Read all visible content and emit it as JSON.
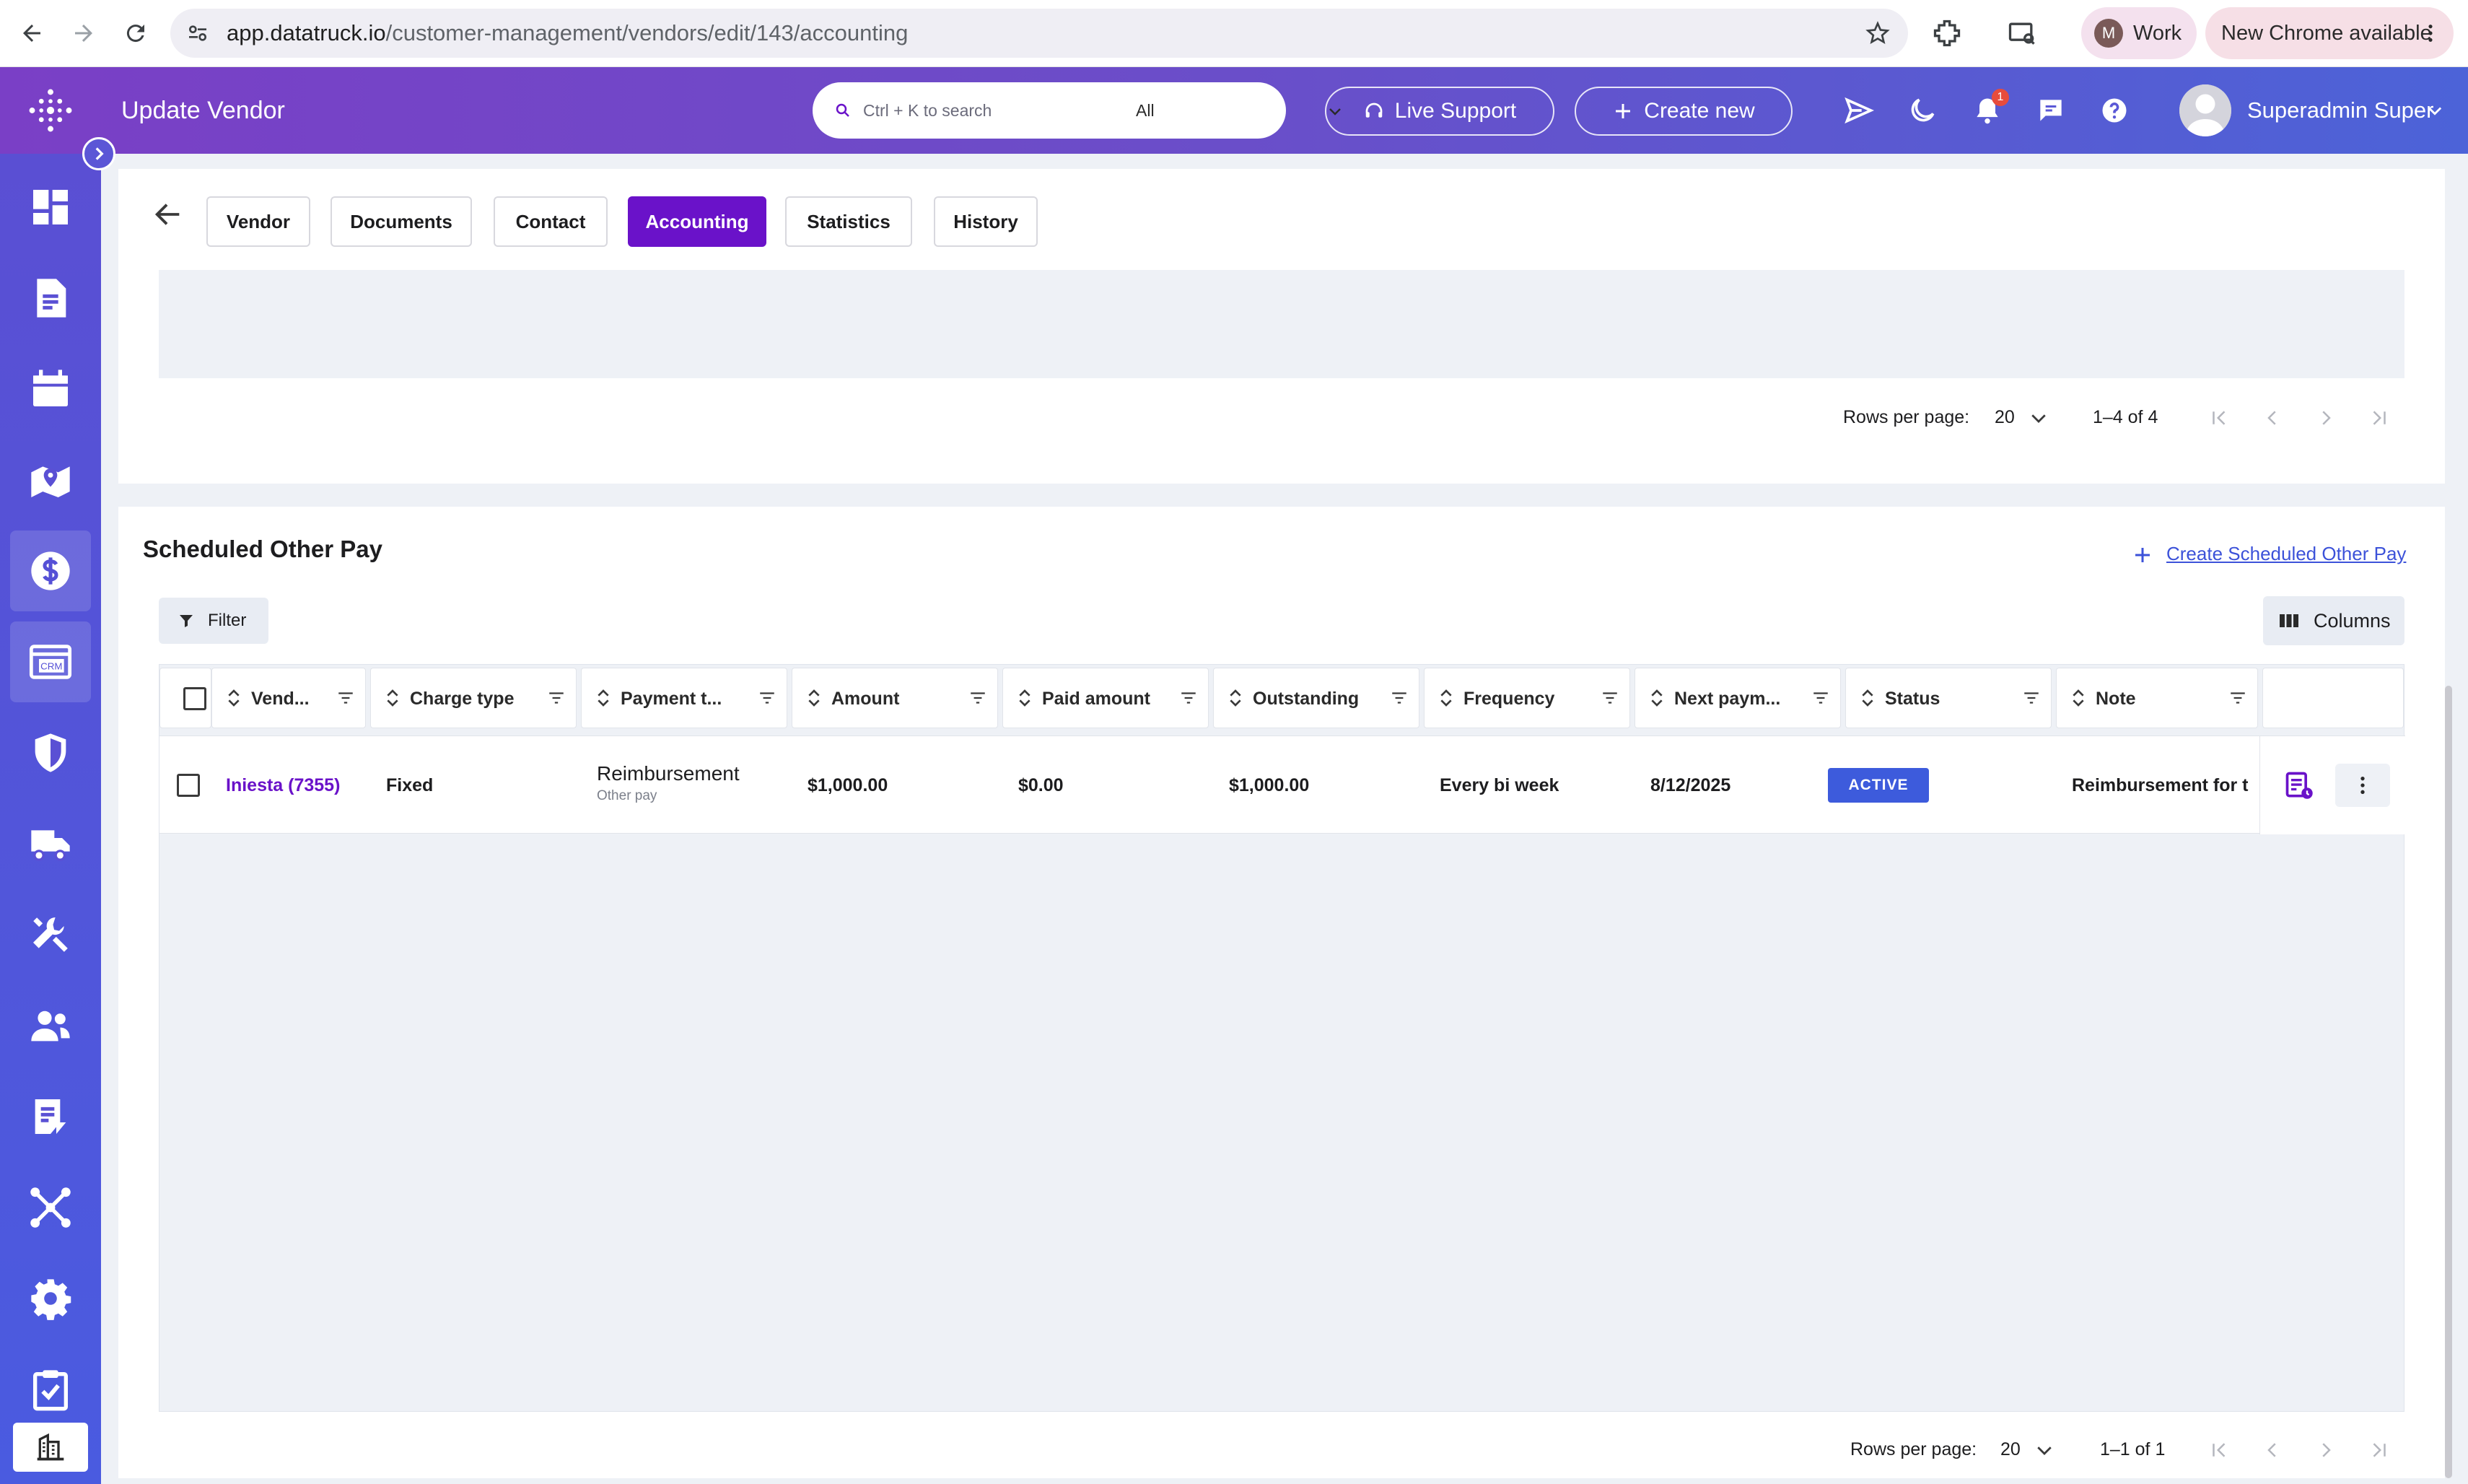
{
  "browser": {
    "url_host": "app.datatruck.io",
    "url_path": "/customer-management/vendors/edit/143/accounting",
    "profile_initial": "M",
    "profile_label": "Work",
    "update_label": "New Chrome available"
  },
  "header": {
    "title": "Update Vendor",
    "search_placeholder": "Ctrl + K to search",
    "search_scope": "All",
    "live_support": "Live Support",
    "create_new": "Create new",
    "notification_count": "1",
    "user_name": "Superadmin Super"
  },
  "sidebar": {
    "items": [
      "dashboard-icon",
      "document-icon",
      "calendar-icon",
      "map-pin-icon",
      "dollar-icon",
      "crm-icon",
      "shield-icon",
      "truck-icon",
      "tools-icon",
      "users-icon",
      "report-icon",
      "network-icon",
      "gear-icon",
      "clipboard-check-icon",
      "building-icon"
    ],
    "active": "dollar-icon",
    "crm_label": "CRM"
  },
  "tabs": [
    "Vendor",
    "Documents",
    "Contact",
    "Accounting",
    "Statistics",
    "History"
  ],
  "active_tab": "Accounting",
  "top_pager": {
    "rows_label": "Rows per page:",
    "rows_value": "20",
    "range": "1–4 of 4"
  },
  "scheduled": {
    "title": "Scheduled Other Pay",
    "create_link": "Create Scheduled Other Pay",
    "filter_label": "Filter",
    "columns_label": "Columns",
    "columns": [
      "Vend...",
      "Charge type",
      "Payment t...",
      "Amount",
      "Paid amount",
      "Outstanding",
      "Frequency",
      "Next paym...",
      "Status",
      "Note"
    ],
    "rows": [
      {
        "vendor": "Iniesta (7355)",
        "charge_type": "Fixed",
        "payment_type": "Reimbursement",
        "payment_subtype": "Other pay",
        "amount": "$1,000.00",
        "paid_amount": "$0.00",
        "outstanding": "$1,000.00",
        "frequency": "Every bi week",
        "next_payment": "8/12/2025",
        "status": "ACTIVE",
        "note": "Reimbursement for t"
      }
    ],
    "pager": {
      "rows_label": "Rows per page:",
      "rows_value": "20",
      "range": "1–1 of 1"
    }
  },
  "colors": {
    "accent_purple": "#6a12c9",
    "status_blue": "#3d5bdc",
    "link_blue": "#3c52d9"
  }
}
